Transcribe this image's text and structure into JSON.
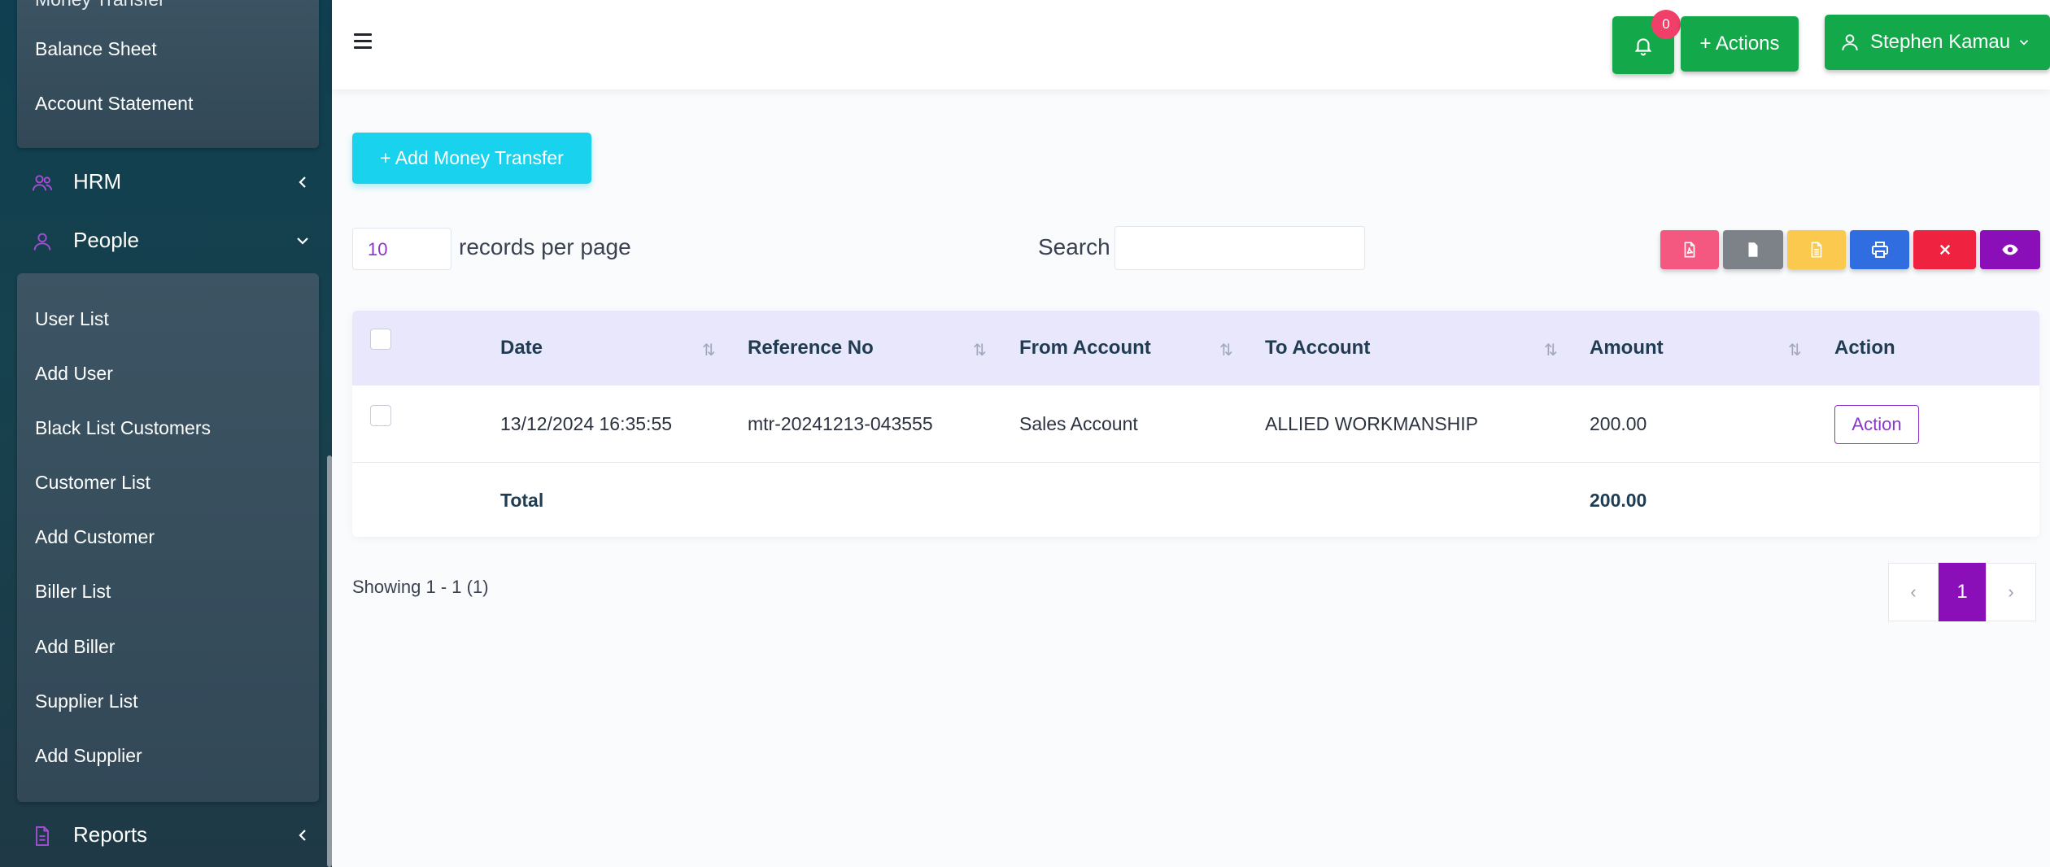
{
  "sidebar": {
    "top_items": [
      "Money Transfer",
      "Balance Sheet",
      "Account Statement"
    ],
    "hrm_label": "HRM",
    "people_label": "People",
    "people_items": [
      "User List",
      "Add User",
      "Black List Customers",
      "Customer List",
      "Add Customer",
      "Biller List",
      "Add Biller",
      "Supplier List",
      "Add Supplier"
    ],
    "reports_label": "Reports"
  },
  "header": {
    "notification_count": "0",
    "actions_label": "+ Actions",
    "user_name": "Stephen Kamau"
  },
  "content": {
    "add_button_label": "+ Add Money Transfer",
    "per_page_value": "10",
    "per_page_label": "records per page",
    "search_label": "Search",
    "search_value": ""
  },
  "table": {
    "columns": [
      "Date",
      "Reference No",
      "From Account",
      "To Account",
      "Amount",
      "Action"
    ],
    "rows": [
      {
        "date": "13/12/2024 16:35:55",
        "reference": "mtr-20241213-043555",
        "from_account": "Sales Account",
        "to_account": "ALLIED WORKMANSHIP",
        "amount": "200.00",
        "action_label": "Action"
      }
    ],
    "total_label": "Total",
    "total_amount": "200.00"
  },
  "footer": {
    "showing": "Showing 1 - 1 (1)",
    "current_page": "1"
  },
  "colors": {
    "sidebar_bg": "#0f3f50",
    "green": "#13a84a",
    "cyan": "#19d2ee",
    "purple": "#8a0fb8",
    "header_row": "#e8e7fb"
  }
}
